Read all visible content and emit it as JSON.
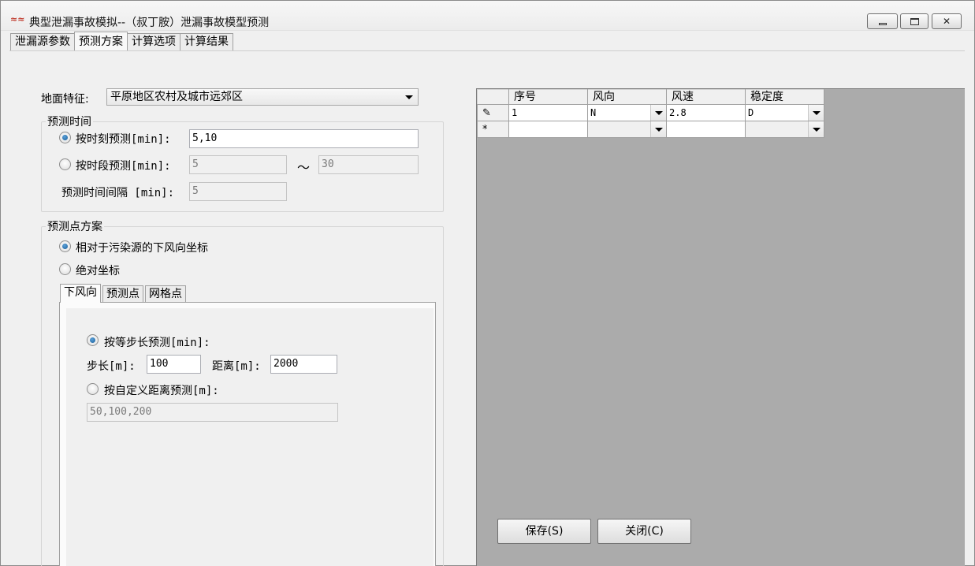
{
  "window": {
    "title": "典型泄漏事故模拟--（叔丁胺）泄漏事故模型预测",
    "app_icon": "app-logo-icon",
    "controls": {
      "minimize": "minimize-icon",
      "maximize": "maximize-icon",
      "close": "close-icon"
    }
  },
  "tabs": [
    "泄漏源参数",
    "预测方案",
    "计算选项",
    "计算结果"
  ],
  "active_tab": "预测方案",
  "surface": {
    "label": "地面特征:",
    "value": "平原地区农村及城市远郊区"
  },
  "forecast_time": {
    "group_title": "预测时间",
    "by_moment_label": "按时刻预测[min]:",
    "by_moment_value": "5,10",
    "by_moment_checked": true,
    "by_period_label": "按时段预测[min]:",
    "period_from": "5",
    "period_sep": "～",
    "period_to": "30",
    "interval_label": "预测时间间隔 [min]:",
    "interval_value": "5"
  },
  "forecast_points": {
    "group_title": "预测点方案",
    "relative_label": "相对于污染源的下风向坐标",
    "relative_checked": true,
    "absolute_label": "绝对坐标",
    "subtabs": [
      "下风向",
      "预测点",
      "网格点"
    ],
    "active_subtab": "下风向",
    "equal_step_label": "按等步长预测[min]:",
    "step_label": "步长[m]:",
    "step_value": "100",
    "distance_label": "距离[m]:",
    "distance_value": "2000",
    "custom_label": "按自定义距离预测[m]:",
    "custom_value": "50,100,200"
  },
  "grid": {
    "columns": [
      "序号",
      "风向",
      "风速",
      "稳定度"
    ],
    "rows": [
      {
        "marker": "✎",
        "seq": "1",
        "dir": "N",
        "speed": "2.8",
        "stability": "D"
      },
      {
        "marker": "*",
        "seq": "",
        "dir": "",
        "speed": "",
        "stability": ""
      }
    ]
  },
  "buttons": {
    "save": "保存(S)",
    "close": "关闭(C)"
  },
  "colors": {
    "radio_accent": "#1b5f9a",
    "grid_background": "#ababab"
  }
}
